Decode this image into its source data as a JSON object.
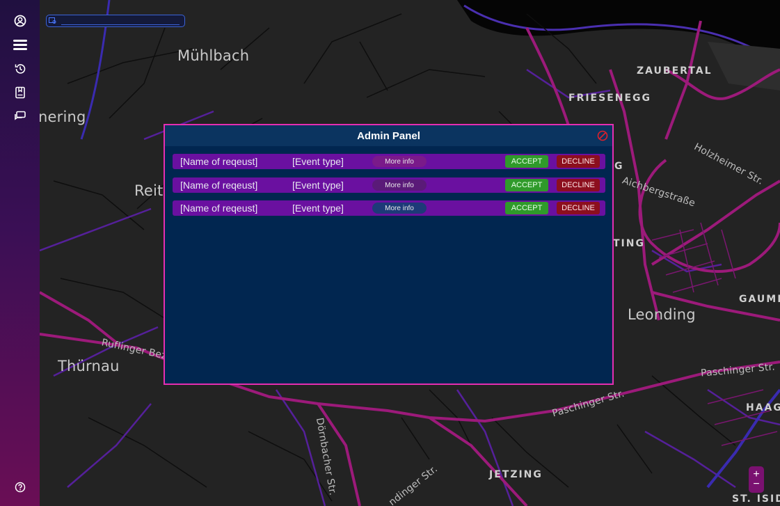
{
  "sidebar": {
    "items": [
      {
        "icon": "user-icon"
      },
      {
        "icon": "menu-icon"
      },
      {
        "icon": "history-icon"
      },
      {
        "icon": "bookmark-icon"
      },
      {
        "icon": "chat-icon"
      }
    ],
    "help_icon": "help-icon"
  },
  "search": {
    "value": "",
    "placeholder": ""
  },
  "map": {
    "labels": {
      "muehlbach": "Mühlbach",
      "zaubertal": "ZAUBERTAL",
      "friesenegg": "FRIESENEGG",
      "nering": "nering",
      "reit": "Reit",
      "thuernau": "Thürnau",
      "leonding": "Leonding",
      "ting": "TING",
      "g": "G",
      "gaumi": "GAUMI",
      "haag": "HAAG",
      "jetzing": "JETZING",
      "st_isid": "ST. ISID",
      "holzheimer": "Holzheimer Str.",
      "aichberg": "Aichbergstraße",
      "paschinger1": "Paschinger Str.",
      "paschinger2": "Paschinger Str.",
      "ruflinger": "Ruflinger Bez",
      "doernbacher": "Dörnbacher Str.",
      "dingerstr": "ndinger Str."
    }
  },
  "zoom": {
    "plus": "+",
    "minus": "−"
  },
  "admin_panel": {
    "title": "Admin Panel",
    "requests": [
      {
        "name": "[Name of reqeust]",
        "type": "[Event type]",
        "more": "More info",
        "more_color": "#7a1a8a",
        "accept": "ACCEPT",
        "decline": "DECLINE"
      },
      {
        "name": "[Name of reqeust]",
        "type": "[Event type]",
        "more": "More info",
        "more_color": "#5a1a78",
        "accept": "ACCEPT",
        "decline": "DECLINE"
      },
      {
        "name": "[Name of reqeust]",
        "type": "[Event type]",
        "more": "More info",
        "more_color": "#1d3a78",
        "accept": "ACCEPT",
        "decline": "DECLINE"
      }
    ]
  },
  "colors": {
    "panel_border": "#e62eb1",
    "panel_bg": "#012650",
    "row_bg": "#6a10a0",
    "accept": "#2f9a2a",
    "decline": "#8c0f1e",
    "road_major": "#9c1a7a",
    "road_purple": "#5a1e9a"
  }
}
